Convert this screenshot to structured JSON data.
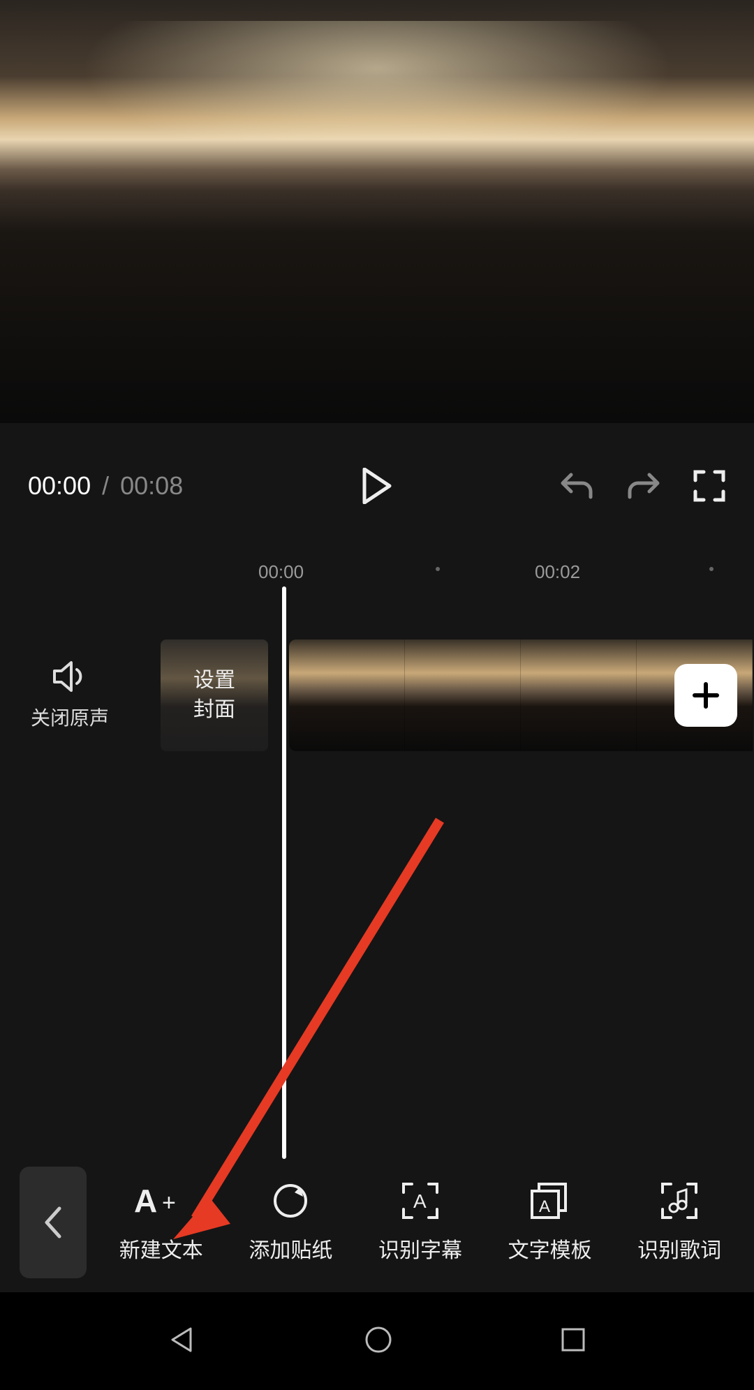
{
  "playback": {
    "current": "00:00",
    "separator": "/",
    "duration": "00:08"
  },
  "ruler": {
    "t0": "00:00",
    "t1": "00:02"
  },
  "mute": {
    "label": "关闭原声"
  },
  "cover": {
    "label": "设置\n封面"
  },
  "add_clip": {
    "glyph": "+"
  },
  "toolbar": {
    "new_text": "新建文本",
    "add_sticker": "添加贴纸",
    "auto_caption": "识别字幕",
    "text_template": "文字模板",
    "auto_lyrics": "识别歌词"
  },
  "icons": {
    "play": "play",
    "undo": "undo",
    "redo": "redo",
    "fullscreen": "fullscreen",
    "speaker": "speaker",
    "plus": "plus",
    "back": "chevron-left",
    "nav_back": "triangle-left",
    "nav_home": "circle",
    "nav_recent": "square"
  },
  "colors": {
    "accent_arrow": "#e63a24"
  }
}
